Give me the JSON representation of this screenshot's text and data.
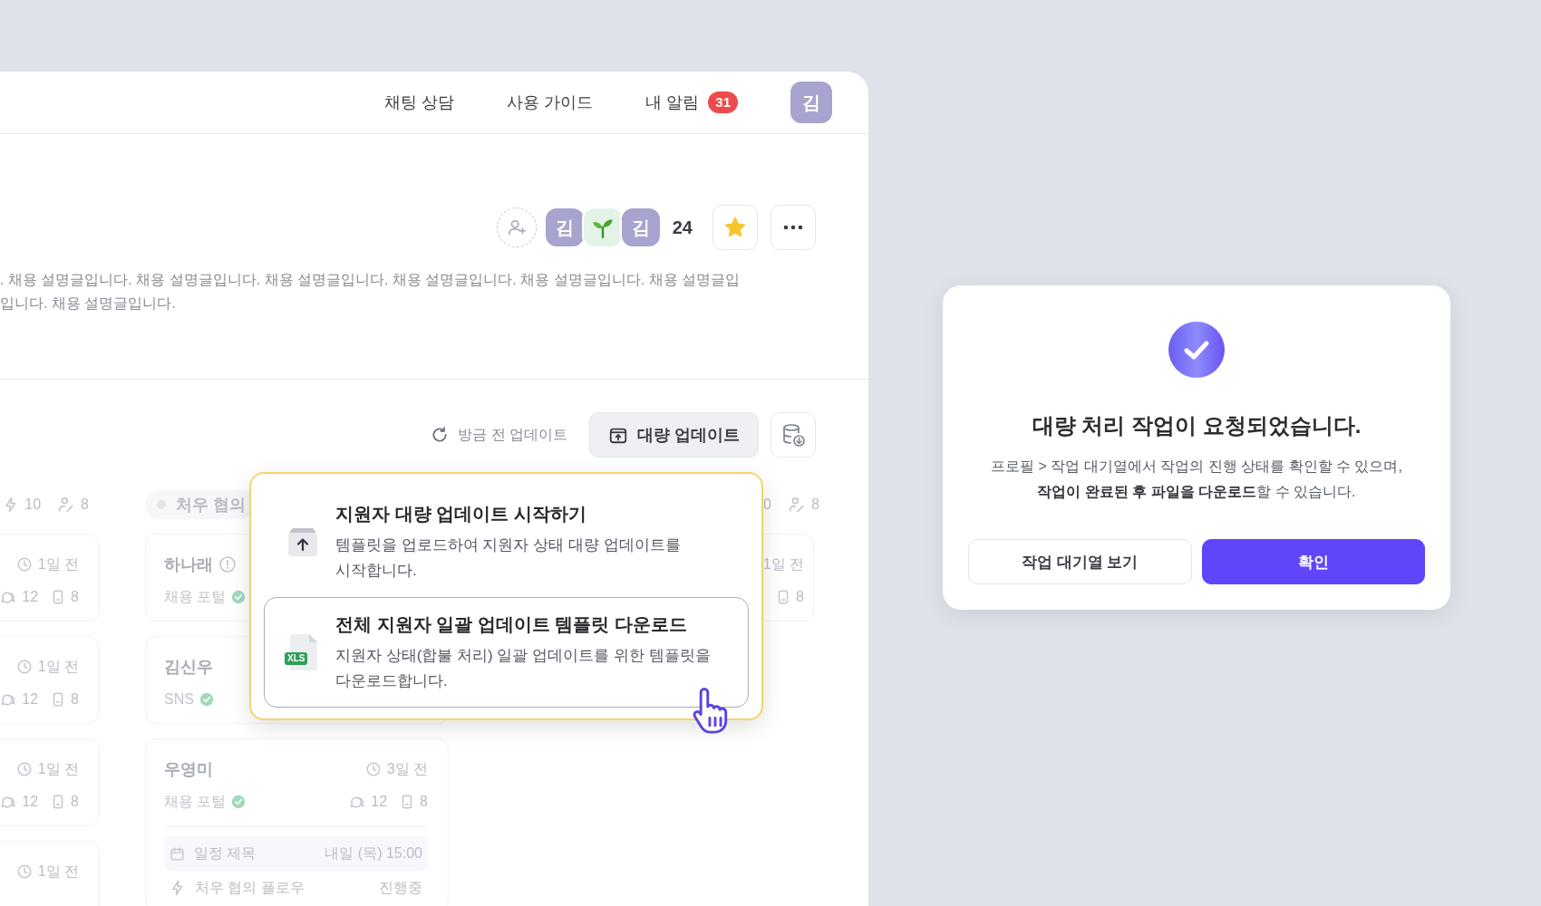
{
  "nav": {
    "links": [
      {
        "label": "채팅 상담"
      },
      {
        "label": "사용 가이드"
      }
    ],
    "alerts": {
      "label": "내 알림",
      "count": "31"
    },
    "avatar": "김"
  },
  "header": {
    "members": [
      {
        "kind": "initial",
        "text": "김"
      },
      {
        "kind": "sprout"
      },
      {
        "kind": "initial",
        "text": "김"
      }
    ],
    "member_count": "24",
    "favorite": {
      "selected": true
    },
    "description_lines": [
      ". 채용 설명글입니다. 채용 설명글입니다. 채용 설명글입니다. 채용 설명글입니다. 채용 설명글입니다. 채용 설명글입",
      "입니다. 채용 설명글입니다."
    ]
  },
  "toolbar": {
    "updated": "방금 전 업데이트",
    "bulk_button": "대량 업데이트"
  },
  "board": {
    "columns": [
      {
        "stats": [
          "10",
          "8"
        ],
        "cards": [
          {
            "time": "1일 전",
            "comments": "12",
            "docs": "8"
          },
          {
            "time": "1일 전",
            "comments": "12",
            "docs": "8"
          },
          {
            "time": "1일 전",
            "comments": "12",
            "docs": "8"
          },
          {
            "time": "1일 전"
          }
        ]
      },
      {
        "title": "처우 협의",
        "cards": [
          {
            "name": "하나래",
            "warning": true,
            "source": "채용 포털",
            "verified": true
          },
          {
            "name": "김신우",
            "warning": false,
            "source": "SNS",
            "verified": true
          },
          {
            "name": "우영미",
            "warning": false,
            "time": "3일 전",
            "source": "채용 포털",
            "verified": true,
            "comments": "12",
            "docs": "8",
            "schedule": {
              "title": "일정 제목",
              "when": "내일 (목) 15:00"
            },
            "flow": {
              "name": "처우 협의 플로우",
              "status": "진행중"
            }
          }
        ]
      },
      {
        "stats": [
          "0",
          "8"
        ],
        "cards": [
          {
            "time": "1일 전",
            "docs": "8"
          }
        ]
      }
    ]
  },
  "bulk_menu": {
    "items": [
      {
        "kind": "upload",
        "title": "지원자 대량 업데이트 시작하기",
        "description": "템플릿을 업로드하여 지원자 상태 대량 업데이트를 시작합니다.",
        "highlighted": false
      },
      {
        "kind": "xls",
        "badge": "XLS",
        "title": "전체 지원자 일괄 업데이트 템플릿 다운로드",
        "description": "지원자 상태(합불 처리) 일괄 업데이트를 위한 템플릿을 다운로드합니다.",
        "highlighted": true
      }
    ]
  },
  "dialog": {
    "title": "대량 처리 작업이 요청되었습니다.",
    "message_lines": [
      "프로필 > 작업 대기열에서 작업의 진행 상태를 확인할 수 있으며,",
      "**작업이 완료된 후 파일을 다운로드**할 수 있습니다."
    ],
    "buttons": [
      {
        "label": "작업 대기열 보기",
        "kind": "secondary"
      },
      {
        "label": "확인",
        "kind": "primary"
      }
    ]
  }
}
